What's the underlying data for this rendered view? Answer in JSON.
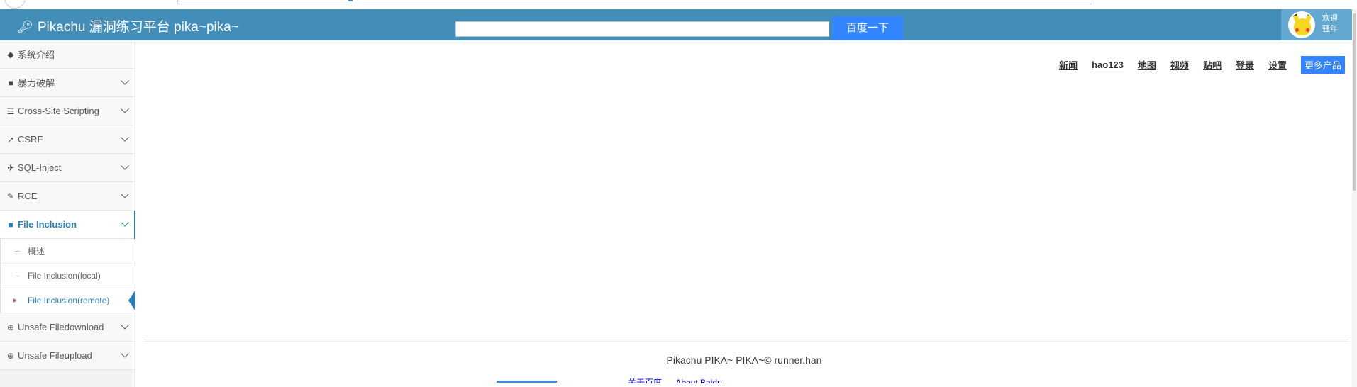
{
  "header": {
    "brand": "Pikachu 漏洞练习平台 pika~pika~",
    "search_button": "百度一下",
    "user_greeting": "欢迎",
    "user_name": "骚年"
  },
  "sidebar": {
    "items": [
      {
        "label": "系统介绍",
        "icon": "tags-icon"
      },
      {
        "label": "暴力破解",
        "icon": "lock-icon"
      },
      {
        "label": "Cross-Site Scripting",
        "icon": "list-icon"
      },
      {
        "label": "CSRF",
        "icon": "share-icon"
      },
      {
        "label": "SQL-Inject",
        "icon": "plane-icon"
      },
      {
        "label": "RCE",
        "icon": "pencil-icon"
      },
      {
        "label": "File Inclusion",
        "icon": "file-icon"
      },
      {
        "label": "Unsafe Filedownload",
        "icon": "download-icon"
      },
      {
        "label": "Unsafe Fileupload",
        "icon": "upload-icon"
      }
    ],
    "sub_items": [
      {
        "label": "概述"
      },
      {
        "label": "File Inclusion(local)"
      },
      {
        "label": "File Inclusion(remote)"
      }
    ]
  },
  "main": {
    "top_links": [
      "新闻",
      "hao123",
      "地图",
      "视频",
      "贴吧",
      "登录",
      "设置"
    ],
    "more_button": "更多产品",
    "footer": "Pikachu PIKA~ PIKA~© runner.han",
    "bottom_links": [
      "关于百度",
      "About  Baidu"
    ]
  },
  "colors": {
    "header_bg": "#438eb9",
    "search_button_bg": "#3385ff",
    "active_nav": "#2b7dbc"
  }
}
